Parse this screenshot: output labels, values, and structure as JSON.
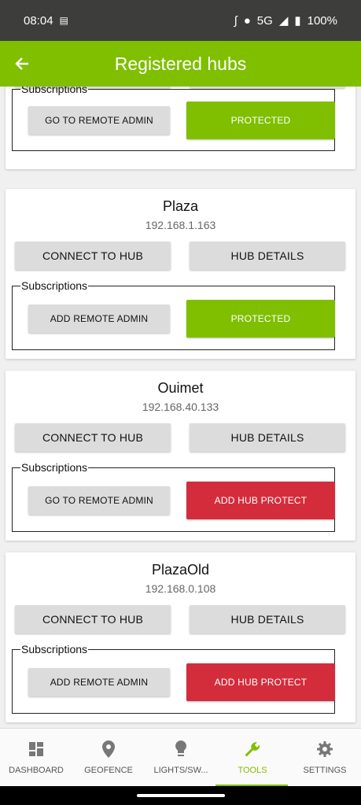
{
  "status_bar": {
    "time": "08:04",
    "network": "5G",
    "battery": "100%"
  },
  "app_bar": {
    "title": "Registered hubs"
  },
  "hubs": [
    {
      "name": "",
      "ip": "",
      "subscriptions_legend": "Subscriptions",
      "remote_admin_label": "GO TO REMOTE ADMIN",
      "protect_label": "PROTECTED",
      "protect_color": "#7fbf00"
    },
    {
      "name": "Plaza",
      "ip": "192.168.1.163",
      "connect_label": "CONNECT TO HUB",
      "details_label": "HUB DETAILS",
      "subscriptions_legend": "Subscriptions",
      "remote_admin_label": "ADD REMOTE ADMIN",
      "protect_label": "PROTECTED",
      "protect_color": "#7fbf00"
    },
    {
      "name": "Ouimet",
      "ip": "192.168.40.133",
      "connect_label": "CONNECT TO HUB",
      "details_label": "HUB DETAILS",
      "subscriptions_legend": "Subscriptions",
      "remote_admin_label": "GO TO REMOTE ADMIN",
      "protect_label": "ADD HUB PROTECT",
      "protect_color": "#d32d3c"
    },
    {
      "name": "PlazaOld",
      "ip": "192.168.0.108",
      "connect_label": "CONNECT TO HUB",
      "details_label": "HUB DETAILS",
      "subscriptions_legend": "Subscriptions",
      "remote_admin_label": "ADD REMOTE ADMIN",
      "protect_label": "ADD HUB PROTECT",
      "protect_color": "#d32d3c"
    }
  ],
  "bottom_nav": {
    "items": [
      {
        "label": "DASHBOARD",
        "icon": "dashboard-icon"
      },
      {
        "label": "GEOFENCE",
        "icon": "location-pin-icon"
      },
      {
        "label": "LIGHTS/SW...",
        "icon": "lightbulb-icon"
      },
      {
        "label": "TOOLS",
        "icon": "wrench-icon",
        "active": true
      },
      {
        "label": "SETTINGS",
        "icon": "gear-icon"
      }
    ]
  },
  "colors": {
    "accent": "#7fbf00",
    "danger": "#d32d3c",
    "status_bar": "#3d3d3b"
  }
}
